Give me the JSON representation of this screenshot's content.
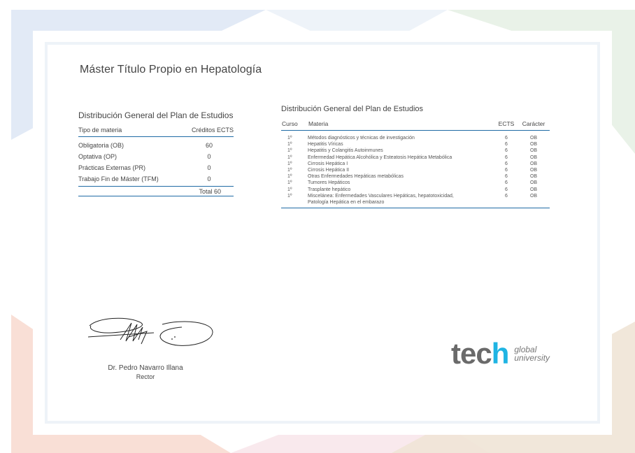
{
  "certificate": {
    "title": "Máster Título Propio en Hepatología"
  },
  "summary_table": {
    "title": "Distribución General del Plan de Estudios",
    "headers": {
      "type": "Tipo de materia",
      "credits": "Créditos ECTS"
    },
    "rows": [
      {
        "type": "Obligatoria (OB)",
        "credits": "60"
      },
      {
        "type": "Optativa (OP)",
        "credits": "0"
      },
      {
        "type": "Prácticas Externas (PR)",
        "credits": "0"
      },
      {
        "type": "Trabajo Fin de Máster (TFM)",
        "credits": "0"
      }
    ],
    "total": "Total 60"
  },
  "subjects_table": {
    "title": "Distribución General del Plan de Estudios",
    "headers": {
      "course": "Curso",
      "subject": "Materia",
      "ects": "ECTS",
      "character": "Carácter"
    },
    "rows": [
      {
        "course": "1º",
        "subject": "Métodos diagnósticos y técnicas de investigación",
        "ects": "6",
        "character": "OB"
      },
      {
        "course": "1º",
        "subject": "Hepatitis Víricas",
        "ects": "6",
        "character": "OB"
      },
      {
        "course": "1º",
        "subject": "Hepatitis y Colangitis Autoinmunes",
        "ects": "6",
        "character": "OB"
      },
      {
        "course": "1º",
        "subject": "Enfermedad Hepática Alcohólica y Esteatosis Hepática Metabólica",
        "ects": "6",
        "character": "OB"
      },
      {
        "course": "1º",
        "subject": "Cirrosis Hepática I",
        "ects": "6",
        "character": "OB"
      },
      {
        "course": "1º",
        "subject": "Cirrosis Hepática II",
        "ects": "6",
        "character": "OB"
      },
      {
        "course": "1º",
        "subject": "Otras Enfermedades Hepáticas metabólicas",
        "ects": "6",
        "character": "OB"
      },
      {
        "course": "1º",
        "subject": "Tumores Hepáticos",
        "ects": "6",
        "character": "OB"
      },
      {
        "course": "1º",
        "subject": "Trasplante hepático",
        "ects": "6",
        "character": "OB"
      },
      {
        "course": "1º",
        "subject": "Miscelánea: Enfermedades Vasculares Hepáticas, hepatotoxicidad,",
        "ects": "6",
        "character": "OB"
      },
      {
        "course": "",
        "subject": "Patología Hepática en el embarazo",
        "ects": "",
        "character": ""
      }
    ]
  },
  "signer": {
    "name": "Dr. Pedro Navarro Illana",
    "role": "Rector"
  },
  "logo": {
    "word_part1": "tec",
    "word_part2": "h",
    "tag_line1": "global",
    "tag_line2": "university"
  },
  "colors": {
    "accent_blue": "#1f6aa5",
    "logo_cyan": "#1fb4e3",
    "logo_gray": "#6a6a6a"
  }
}
